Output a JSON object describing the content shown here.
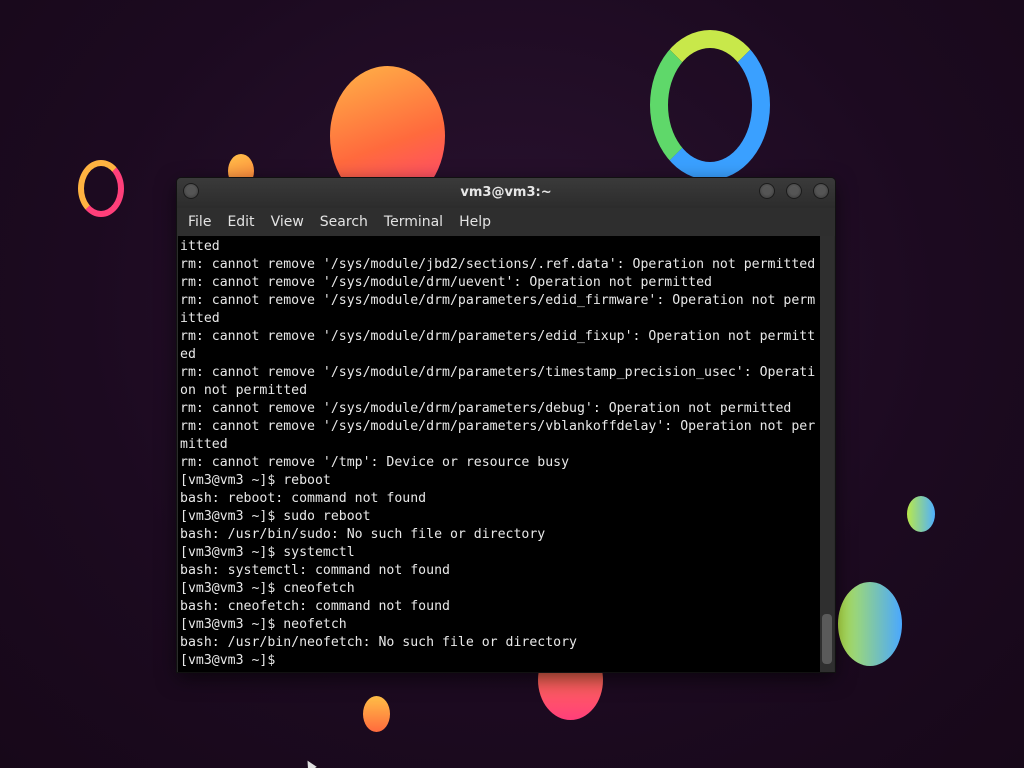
{
  "window": {
    "title": "vm3@vm3:~",
    "menu": [
      "File",
      "Edit",
      "View",
      "Search",
      "Terminal",
      "Help"
    ]
  },
  "terminal": {
    "lines": [
      "itted",
      "rm: cannot remove '/sys/module/jbd2/sections/.ref.data': Operation not permitted",
      "rm: cannot remove '/sys/module/drm/uevent': Operation not permitted",
      "rm: cannot remove '/sys/module/drm/parameters/edid_firmware': Operation not perm",
      "itted",
      "rm: cannot remove '/sys/module/drm/parameters/edid_fixup': Operation not permitt",
      "ed",
      "rm: cannot remove '/sys/module/drm/parameters/timestamp_precision_usec': Operati",
      "on not permitted",
      "rm: cannot remove '/sys/module/drm/parameters/debug': Operation not permitted",
      "rm: cannot remove '/sys/module/drm/parameters/vblankoffdelay': Operation not per",
      "mitted",
      "rm: cannot remove '/tmp': Device or resource busy",
      "[vm3@vm3 ~]$ reboot",
      "bash: reboot: command not found",
      "[vm3@vm3 ~]$ sudo reboot",
      "bash: /usr/bin/sudo: No such file or directory",
      "[vm3@vm3 ~]$ systemctl",
      "bash: systemctl: command not found",
      "[vm3@vm3 ~]$ cneofetch",
      "bash: cneofetch: command not found",
      "[vm3@vm3 ~]$ neofetch",
      "bash: /usr/bin/neofetch: No such file or directory",
      "[vm3@vm3 ~]$"
    ]
  },
  "colors": {
    "terminal_bg": "#000000",
    "terminal_fg": "#e8e8e8",
    "window_chrome": "#2e2e2e",
    "desktop_bg": "#1f0d23"
  },
  "icons": {
    "window_buttons": [
      "window-menu-icon",
      "minimize-icon",
      "maximize-icon",
      "close-icon"
    ]
  }
}
